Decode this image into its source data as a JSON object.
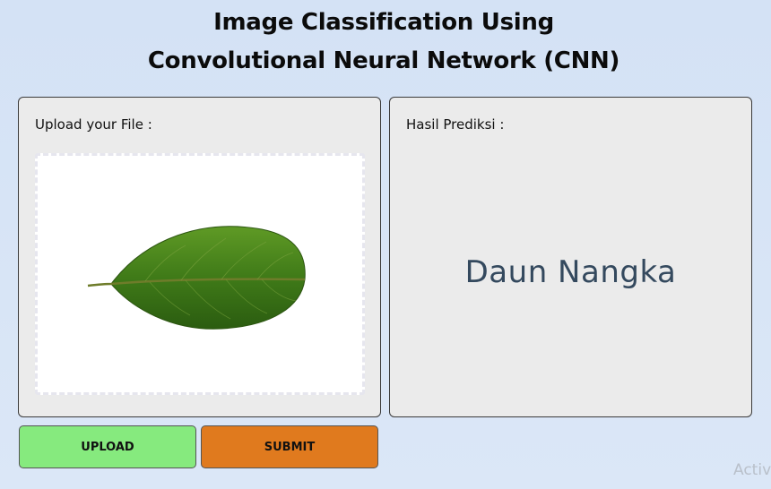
{
  "header": {
    "title_line1": "Image Classification Using",
    "title_line2": "Convolutional Neural Network (CNN)"
  },
  "upload_panel": {
    "label": "Upload your File :",
    "preview_icon": "leaf-image"
  },
  "result_panel": {
    "label": "Hasil Prediksi :",
    "prediction": "Daun Nangka"
  },
  "buttons": {
    "upload_label": "UPLOAD",
    "submit_label": "SUBMIT"
  },
  "watermark": "Activ",
  "colors": {
    "upload_button": "#86ea7e",
    "submit_button": "#e07a1e",
    "prediction_text": "#34495e",
    "panel_bg": "#ebebeb"
  }
}
